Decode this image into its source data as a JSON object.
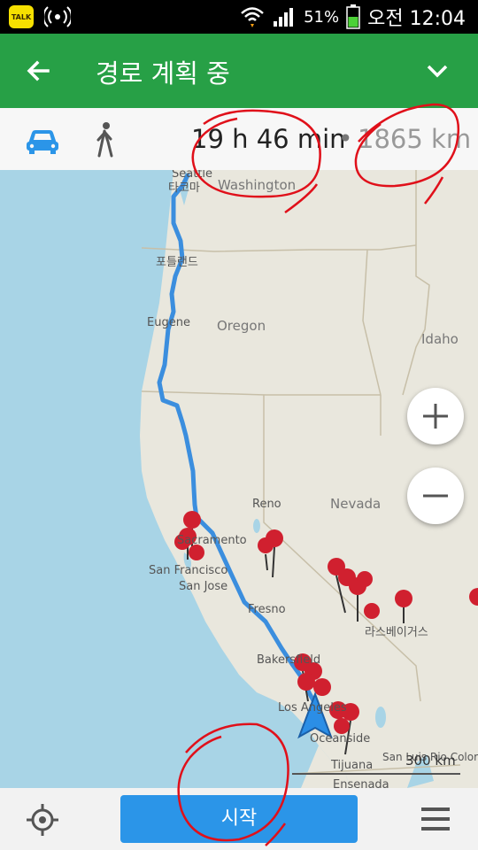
{
  "status_bar": {
    "kakao_icon_text": "TALK",
    "battery_percent": "51%",
    "time": "오전 12:04"
  },
  "app_bar": {
    "title": "경로 계획 중"
  },
  "route_info": {
    "travel_time": "19 h 46 min",
    "separator": "•",
    "distance": "1865 km"
  },
  "map": {
    "labels": {
      "seattle": "Seattle",
      "seattle_ko": "타코마",
      "washington": "Washington",
      "portland_ko": "포틀랜드",
      "eugene": "Eugene",
      "oregon": "Oregon",
      "idaho": "Idaho",
      "reno": "Reno",
      "nevada": "Nevada",
      "sacramento": "Sacramento",
      "san_francisco": "San Francisco",
      "san_jose": "San Jose",
      "fresno": "Fresno",
      "las_vegas_ko": "라스베이거스",
      "bakersfield": "Bakersfield",
      "los_angeles": "Los Angeles",
      "oceanside": "Oceanside",
      "tijuana": "Tijuana",
      "san_luis_rio_colorado": "San Luis Rio Colorado",
      "ensenada": "Ensenada",
      "scale": "300 km"
    }
  },
  "bottom_bar": {
    "start_label": "시작"
  },
  "colors": {
    "app_bar": "#27a046",
    "route": "#3b8ede",
    "start_button": "#2b95e8",
    "poi_pin": "#d0202f",
    "annotation": "#e0101a"
  }
}
